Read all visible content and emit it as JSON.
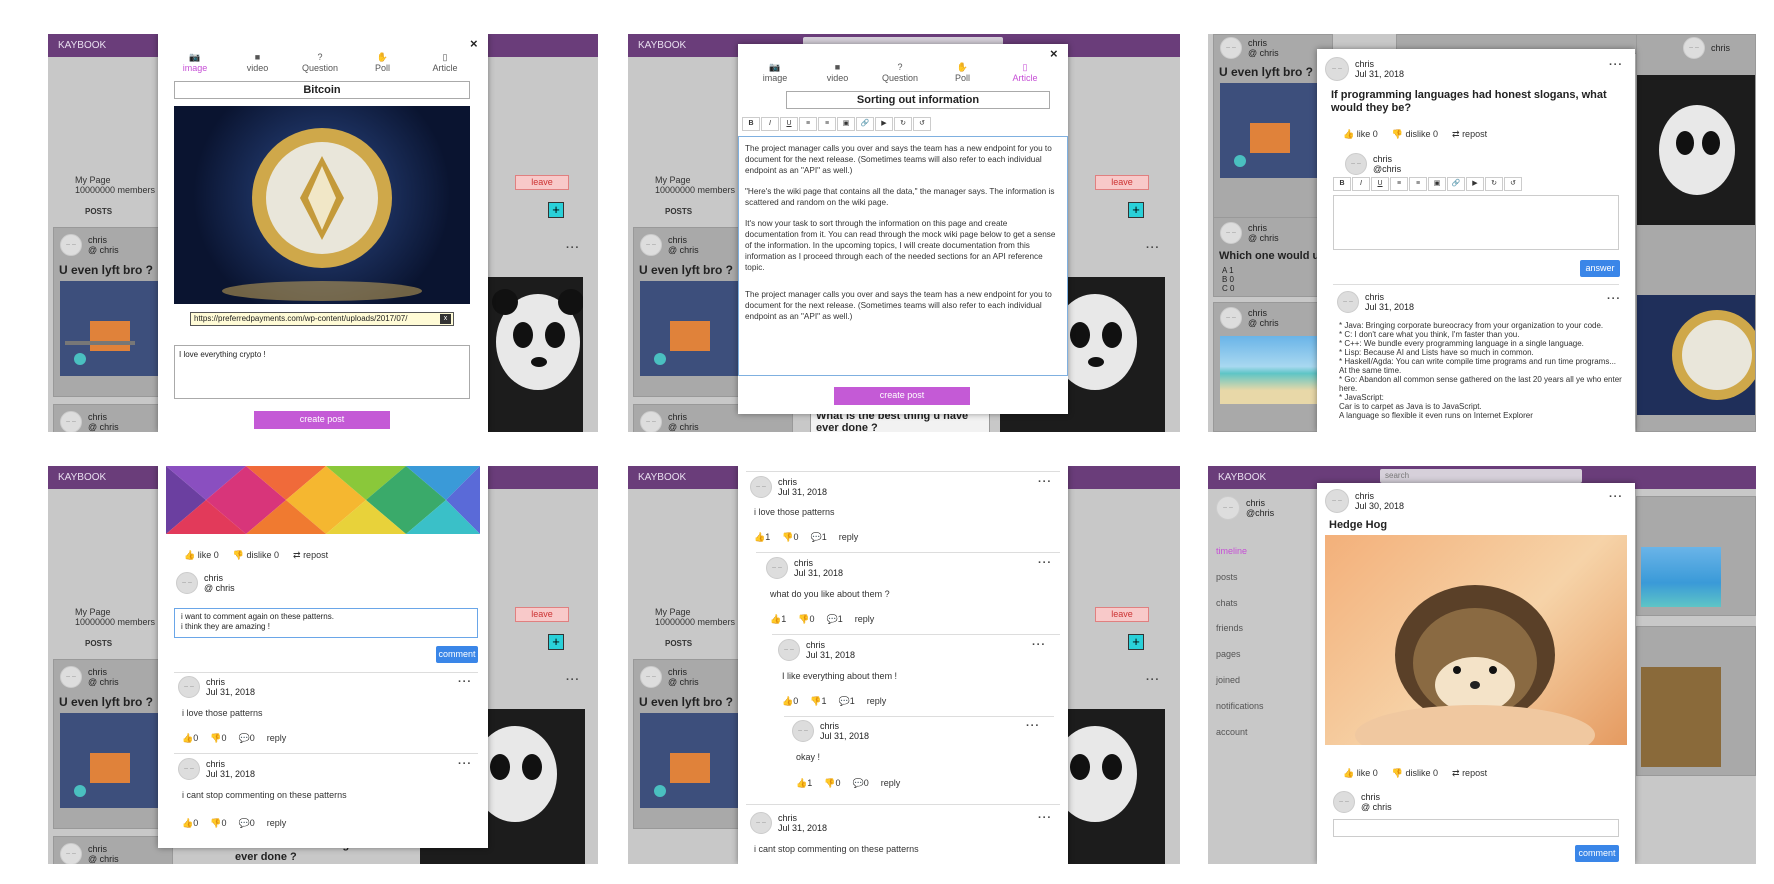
{
  "app": {
    "brand": "KAYBOOK",
    "search_placeholder": "search"
  },
  "group": {
    "name": "My Page",
    "members": "10000000 members",
    "leave_label": "leave",
    "posts_tab": "POSTS",
    "add_label": "+"
  },
  "posts": {
    "gym": {
      "user": "chris",
      "handle": "@ chris",
      "title": "U even lyft bro ?"
    },
    "which": {
      "user": "chris",
      "handle": "@ chris",
      "title": "Which one would u",
      "options": [
        "A 1",
        "B 0",
        "C 0"
      ]
    },
    "beach": {
      "user": "chris",
      "handle": "@ chris"
    },
    "best": {
      "title": "What is the best thing u have ever done ?"
    },
    "partial": {
      "user": "chris",
      "handle": "@ chris"
    }
  },
  "modal_image": {
    "tabs": [
      "image",
      "video",
      "Question",
      "Poll",
      "Article"
    ],
    "title": "Bitcoin",
    "url": "https://preferredpayments.com/wp-content/uploads/2017/07/",
    "clear_label": "x",
    "description": "I love everything crypto !",
    "submit": "create post",
    "close": "×"
  },
  "modal_article": {
    "title": "Sorting out information",
    "toolbar": [
      "B",
      "I",
      "U",
      "≡",
      "≡",
      "▣",
      "🔗",
      "▶",
      "↻",
      "↺"
    ],
    "paragraphs": [
      "The project manager calls you over and says the team has a new endpoint for you to document for the next release. (Sometimes teams will also refer to each individual endpoint as an \"API\" as well.)",
      "\"Here's the wiki page that contains all the data,\" the manager says. The information is scattered and random on the wiki page.",
      "It's now your task to sort through the information on this page and create documentation from it. You can read through the mock wiki page below to get a sense of the information. In the upcoming topics, I will create documentation from this information as I proceed through each of the needed sections for an API reference topic.",
      "The project manager calls you over and says the team has a new endpoint for you to document for the next release. (Sometimes teams will also refer to each individual endpoint as an \"API\" as well.)"
    ],
    "submit": "create post"
  },
  "question": {
    "user": "chris",
    "date": "Jul 31, 2018",
    "title": "If programming languages had honest slogans, what would they be?",
    "like": "like 0",
    "dislike": "dislike 0",
    "repost": "repost",
    "me_user": "chris",
    "me_handle": "@chris",
    "answer_btn": "answer",
    "answer_user": "chris",
    "answer_date": "Jul 31, 2018",
    "answer_lines": [
      "* Java: Bringing corporate bureocracy from your organization to your code.",
      "* C: I don't care what you think, I'm faster than you.",
      "* C++: We bundle every programming language in a single language.",
      "* Lisp: Because AI and Lists have so much in common.",
      "* Haskell/Agda: You can write compile time programs and run time programs... At the same time.",
      "* Go: Abandon all common sense gathered on the last 20 years all ye who enter here.",
      "* JavaScript:",
      "Car is to carpet as Java is to JavaScript.",
      "A language so flexible it even runs on Internet Explorer"
    ]
  },
  "comment_modal": {
    "like": "like 0",
    "dislike": "dislike 0",
    "repost": "repost",
    "me_user": "chris",
    "me_handle": "@ chris",
    "draft": "i want to comment again on these patterns.\ni think they are amazing !",
    "comment_btn": "comment",
    "comments": [
      {
        "user": "chris",
        "date": "Jul 31, 2018",
        "text": "i love those patterns",
        "up": "0",
        "down": "0",
        "replies": "0",
        "reply": "reply"
      },
      {
        "user": "chris",
        "date": "Jul 31, 2018",
        "text": "i cant stop commenting on these patterns",
        "up": "0",
        "down": "0",
        "replies": "0",
        "reply": "reply"
      }
    ]
  },
  "thread": [
    {
      "user": "chris",
      "date": "Jul 31, 2018",
      "text": "i love those patterns",
      "up": "1",
      "down": "0",
      "replies": "1",
      "reply": "reply"
    },
    {
      "user": "chris",
      "date": "Jul 31, 2018",
      "text": "what do you like about them ?",
      "up": "1",
      "down": "0",
      "replies": "1",
      "reply": "reply"
    },
    {
      "user": "chris",
      "date": "Jul 31, 2018",
      "text": "I like everything about them !",
      "up": "0",
      "down": "1",
      "replies": "1",
      "reply": "reply"
    },
    {
      "user": "chris",
      "date": "Jul 31, 2018",
      "text": "okay !",
      "up": "1",
      "down": "0",
      "replies": "0",
      "reply": "reply"
    },
    {
      "user": "chris",
      "date": "Jul 31, 2018",
      "text": "i cant stop commenting on these patterns"
    }
  ],
  "profile": {
    "user": "chris",
    "handle": "@chris",
    "links": [
      "timeline",
      "posts",
      "chats",
      "friends",
      "pages",
      "joined",
      "notifications",
      "account"
    ]
  },
  "hedgehog": {
    "user": "chris",
    "date": "Jul 30, 2018",
    "title": "Hedge Hog",
    "like": "like 0",
    "dislike": "dislike 0",
    "repost": "repost",
    "me_user": "chris",
    "me_handle": "@ chris",
    "comment_btn": "comment"
  },
  "colors": {
    "topbar": "#6a3d7a",
    "purple_button": "#c45ad6",
    "blue_button": "#3a86e8",
    "active_tab": "#c64fd6"
  }
}
